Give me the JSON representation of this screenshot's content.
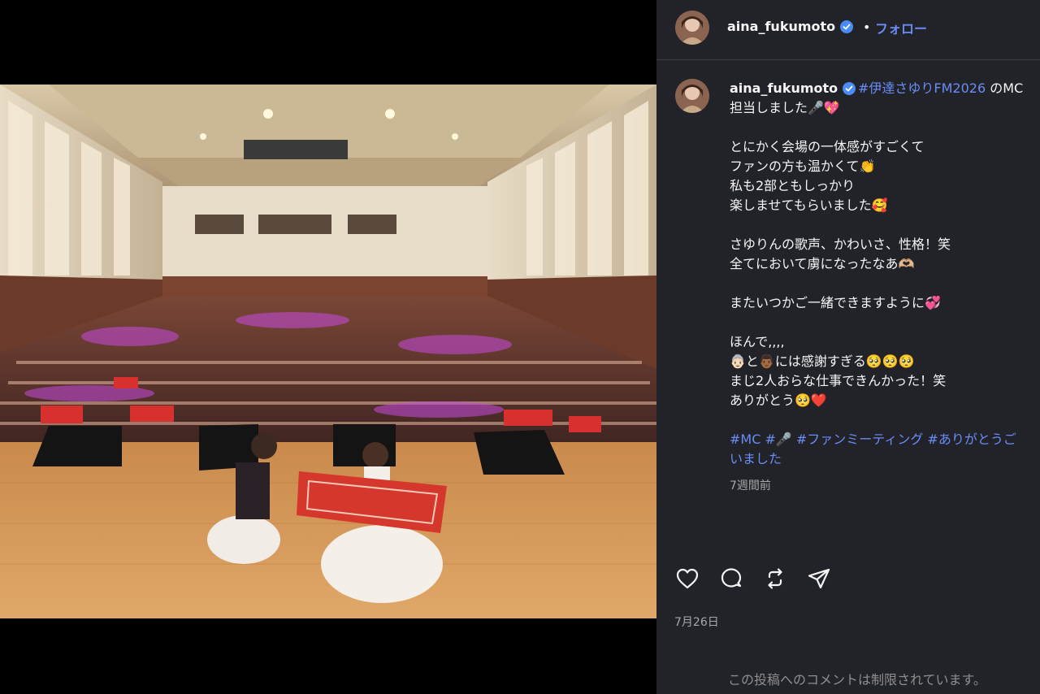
{
  "post": {
    "username": "aina_fukumoto",
    "follow_label": "フォロー",
    "separator": "•",
    "photo_alt": "",
    "carousel": {
      "count": 3,
      "active_index": 2
    }
  },
  "caption": {
    "username": "aina_fukumoto",
    "line1_tag": "#伊達さゆりFM2026",
    "line1_text": " のMC",
    "lines": [
      "担当しました🎤💖",
      "",
      "とにかく会場の一体感がすごくて",
      "ファンの方も温かくて👏",
      "私も2部ともしっかり",
      "楽しませてもらいました🥰",
      "",
      "さゆりんの歌声、かわいさ、性格！笑",
      "全てにおいて虜になったなあ🫶🏼",
      "",
      "またいつかご一緒できますように💞",
      "",
      "ほんで,,,,",
      "👵🏻と👨🏾には感謝すぎる🥺🥺🥺",
      "まじ2人おらな仕事できんかった！笑",
      "ありがとう🥺❤️",
      ""
    ],
    "hashtags_line1": "#MC #🎤 #ファンミーティング #ありがとうご",
    "hashtags_line2": "いました",
    "time_ago": "7週間前"
  },
  "actions": {
    "like_icon": "heart-icon",
    "comment_icon": "comment-icon",
    "repost_icon": "repost-icon",
    "share_icon": "share-icon"
  },
  "date": "7月26日",
  "comments_restricted": "この投稿へのコメントは制限されています。",
  "colors": {
    "panel_bg": "#212328",
    "link": "#6a8cf6",
    "verified": "#4a8cf5",
    "muted": "#a8a8a8"
  }
}
